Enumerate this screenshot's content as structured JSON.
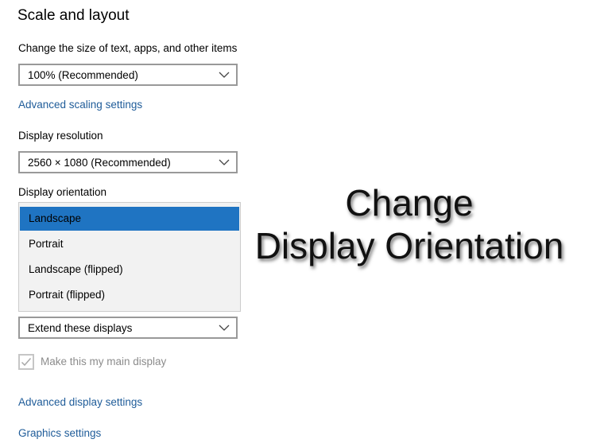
{
  "section": {
    "title": "Scale and layout"
  },
  "scale": {
    "label": "Change the size of text, apps, and other items",
    "value": "100% (Recommended)",
    "advanced_link": "Advanced scaling settings"
  },
  "resolution": {
    "label": "Display resolution",
    "value": "2560 × 1080 (Recommended)"
  },
  "orientation": {
    "label": "Display orientation",
    "options": [
      "Landscape",
      "Portrait",
      "Landscape (flipped)",
      "Portrait (flipped)"
    ],
    "selected": "Landscape"
  },
  "multiple_displays": {
    "value": "Extend these displays"
  },
  "main_display": {
    "label": "Make this my main display",
    "checked": true,
    "enabled": false
  },
  "links": {
    "advanced_display": "Advanced display settings",
    "graphics": "Graphics settings"
  },
  "overlay": {
    "line1": "Change",
    "line2": "Display Orientation"
  },
  "colors": {
    "link": "#1f5c99",
    "selected_option": "#1f74c2",
    "dropdown_bg": "#f2f2f2",
    "disabled_text": "#8c8c8c"
  },
  "icons": {
    "chevron": "chevron-down-icon",
    "check": "checkmark-icon"
  }
}
